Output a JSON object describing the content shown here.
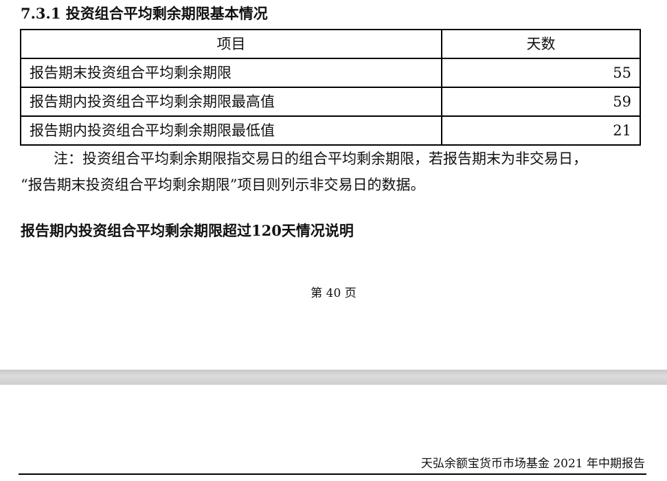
{
  "section": {
    "heading": "7.3.1 投资组合平均剩余期限基本情况"
  },
  "table": {
    "headers": [
      "项目",
      "天数"
    ],
    "rows": [
      {
        "item": "报告期末投资组合平均剩余期限",
        "days": "55"
      },
      {
        "item": "报告期内投资组合平均剩余期限最高值",
        "days": "59"
      },
      {
        "item": "报告期内投资组合平均剩余期限最低值",
        "days": "21"
      }
    ]
  },
  "note": {
    "line1": "注：投资组合平均剩余期限指交易日的组合平均剩余期限，若报告期末为非交易日，",
    "line2": "“报告期末投资组合平均剩余期限”项目则列示非交易日的数据。"
  },
  "subsection": {
    "heading": "报告期内投资组合平均剩余期限超过120天情况说明"
  },
  "footer": {
    "page_number": "第 40 页"
  },
  "next_page": {
    "running_header": "天弘余额宝货币市场基金 2021 年中期报告"
  },
  "colors": {
    "text": "#111111",
    "border": "#000000",
    "page_gap": "#d0d0d0"
  }
}
